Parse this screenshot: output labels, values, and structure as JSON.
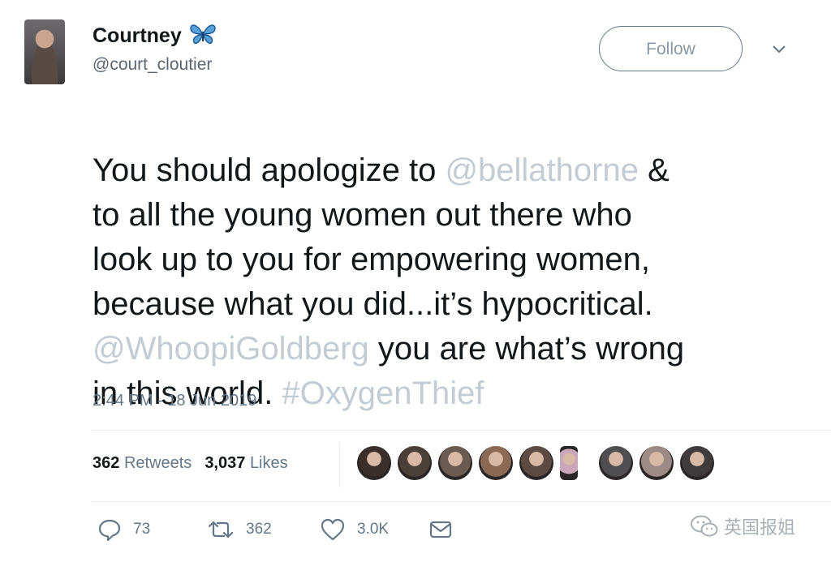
{
  "user": {
    "name": "Courtney",
    "handle": "@court_cloutier"
  },
  "follow_label": "Follow",
  "tweet": {
    "segments": [
      {
        "text": "You should apologize to ",
        "link": false
      },
      {
        "text": "@bellathorne",
        "link": true
      },
      {
        "text": " &\nto all the young women out there who\nlook up to you for empowering women,\nbecause what you did...it’s hypocritical.\n",
        "link": false
      },
      {
        "text": "@WhoopiGoldberg",
        "link": true
      },
      {
        "text": " you are what’s wrong\nin this world. ",
        "link": false
      },
      {
        "text": "#OxygenThief",
        "link": true
      }
    ],
    "timestamp": "2:44 PM - 18 Jun 2019"
  },
  "stats": {
    "retweets_count": "362",
    "retweets_label": "Retweets",
    "likes_count": "3,037",
    "likes_label": "Likes"
  },
  "likers_avatar_colors": [
    "#3a2f2b",
    "#4a4038",
    "#6b5a50",
    "#8a6a55",
    "#5d4a42",
    "#c9a6b8",
    "#4f4f52",
    "#9d8a86",
    "#3f3b3d"
  ],
  "actions": {
    "replies": "73",
    "retweets": "362",
    "likes": "3.0K"
  },
  "watermark": "英国报姐",
  "colors": {
    "link": "#c3ccd3",
    "secondary_text": "#657786",
    "butterfly": "#5aa0d8"
  }
}
